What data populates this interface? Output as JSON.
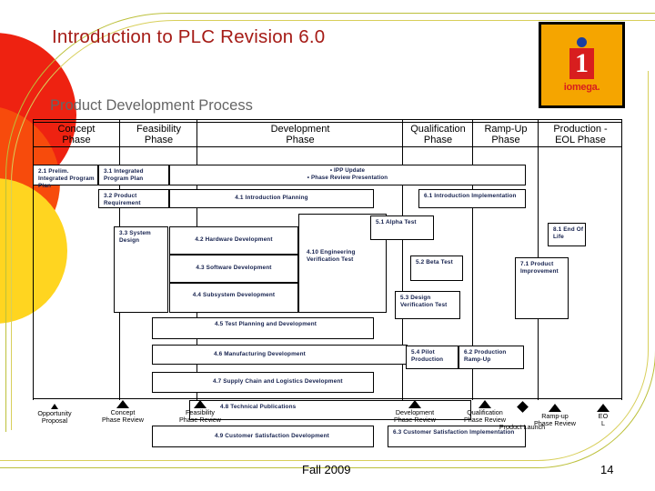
{
  "slide": {
    "title": "Introduction to PLC Revision 6.0",
    "chart_title": "Product Development Process",
    "footer_date": "Fall 2009",
    "footer_page": "14"
  },
  "logo": {
    "mark": "1",
    "wordmark": "iomega.",
    "bg_color": "#f5a500",
    "square_color": "#d81e1e",
    "dot_color": "#1a3fa0"
  },
  "colors": {
    "title": "#a51b16",
    "chart_title": "#666666",
    "box_text": "#14204d",
    "deco_red": "#ee2211",
    "deco_orange": "#f74b0c",
    "deco_yellow": "#ffd520",
    "swoosh": "#bcc03a"
  },
  "phases": [
    {
      "name": "Concept",
      "sub": "Phase"
    },
    {
      "name": "Feasibility",
      "sub": "Phase"
    },
    {
      "name": "Development",
      "sub": "Phase"
    },
    {
      "name": "Qualification",
      "sub": "Phase"
    },
    {
      "name": "Ramp-Up",
      "sub": "Phase"
    },
    {
      "name": "Production -",
      "sub": "EOL Phase"
    }
  ],
  "tasks": [
    {
      "id": "t1",
      "label": "2.1 Prelim. Integrated Program Plan"
    },
    {
      "id": "t2",
      "label": "3.1 Integrated Program Plan"
    },
    {
      "id": "t3",
      "label": "• IPP Update\n• Phase Review Presentation"
    },
    {
      "id": "t4",
      "label": "3.2 Product Requirement"
    },
    {
      "id": "t5",
      "label": "4.1 Introduction Planning"
    },
    {
      "id": "t6",
      "label": "6.1 Introduction Implementation"
    },
    {
      "id": "t7",
      "label": "3.3 System Design"
    },
    {
      "id": "t8",
      "label": "4.2 Hardware Development"
    },
    {
      "id": "t9",
      "label": "4.3 Software Development"
    },
    {
      "id": "t10",
      "label": "4.4 Subsystem Development"
    },
    {
      "id": "t11",
      "label": "4.10 Engineering Verification Test"
    },
    {
      "id": "t12",
      "label": "5.1 Alpha Test"
    },
    {
      "id": "t13",
      "label": "5.2 Beta Test"
    },
    {
      "id": "t14",
      "label": "5.3 Design Verification Test"
    },
    {
      "id": "t15",
      "label": "8.1 End Of Life"
    },
    {
      "id": "t16",
      "label": "7.1 Product Improvement"
    },
    {
      "id": "t17",
      "label": "4.5 Test Planning and Development"
    },
    {
      "id": "t18",
      "label": "4.6 Manufacturing Development"
    },
    {
      "id": "t19",
      "label": "4.7 Supply Chain and Logistics Development"
    },
    {
      "id": "t20",
      "label": "4.8 Technical Publications"
    },
    {
      "id": "t21",
      "label": "4.9 Customer Satisfaction Development"
    },
    {
      "id": "t22",
      "label": "5.4 Pilot Production"
    },
    {
      "id": "t23",
      "label": "6.2 Production Ramp-Up"
    },
    {
      "id": "t24",
      "label": "6.3 Customer Satisfaction Implementation"
    }
  ],
  "milestones": [
    {
      "id": "m1",
      "label": "Opportunity\nProposal",
      "marker": "triangle-small"
    },
    {
      "id": "m2",
      "label": "Concept\nPhase Review",
      "marker": "triangle"
    },
    {
      "id": "m3",
      "label": "Feasibility\nPhase Review",
      "marker": "triangle"
    },
    {
      "id": "m4",
      "label": "Development\nPhase Review",
      "marker": "triangle"
    },
    {
      "id": "m5",
      "label": "Qualification\nPhase Review",
      "marker": "triangle"
    },
    {
      "id": "m6",
      "label": "Product Launch",
      "marker": "diamond"
    },
    {
      "id": "m7",
      "label": "Ramp-up\nPhase Review",
      "marker": "triangle"
    },
    {
      "id": "m8",
      "label": "EO\nL",
      "marker": "triangle"
    }
  ]
}
